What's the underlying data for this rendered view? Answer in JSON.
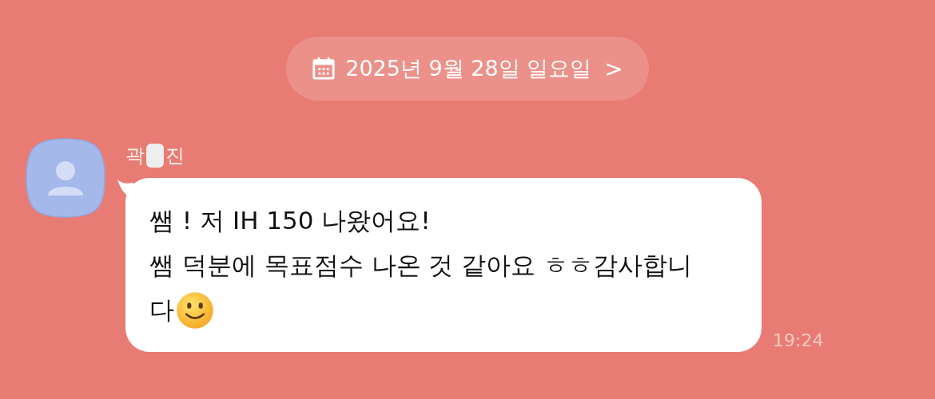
{
  "date_divider": {
    "label": "2025년 9월 28일 일요일",
    "chevron": ">"
  },
  "message": {
    "sender_parts": [
      "곽",
      "진"
    ],
    "sender_redacted": true,
    "lines": [
      "쌤 ! 저 IH 150 나왔어요!",
      "쌤 덕분에 목표점수 나온 것 같아요  ㅎㅎ감사합니",
      "다"
    ],
    "time": "19:24"
  }
}
